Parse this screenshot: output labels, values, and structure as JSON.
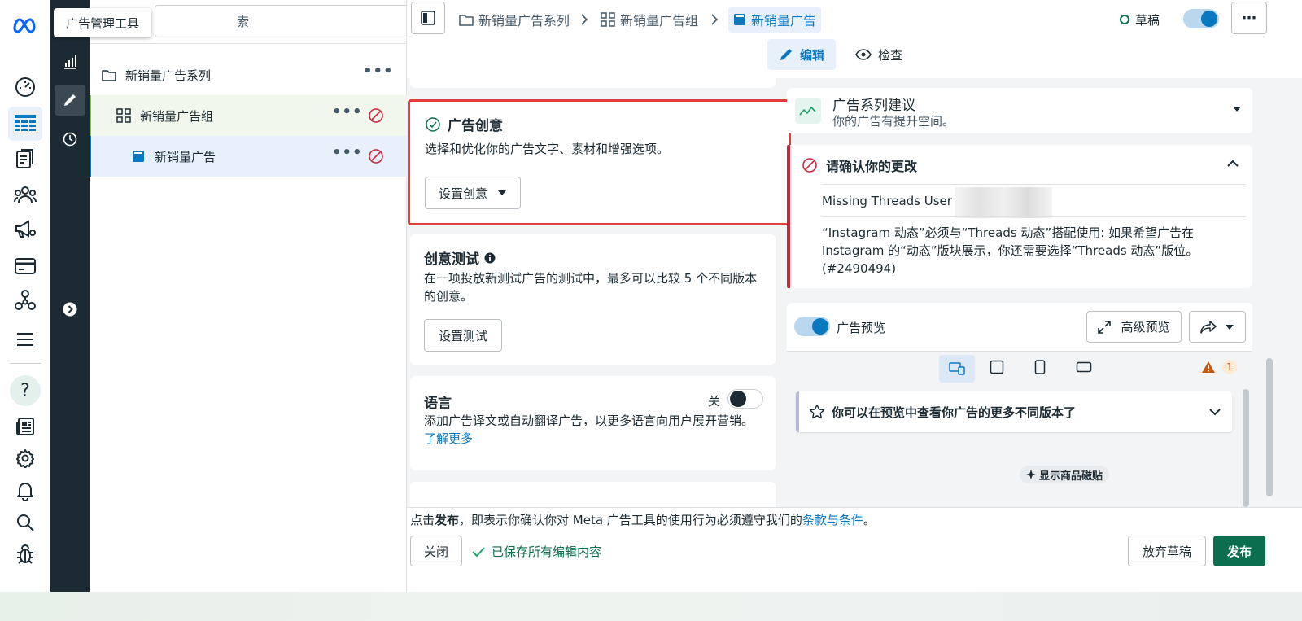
{
  "tooltip": "广告管理工具",
  "search": {
    "placeholder": "索"
  },
  "tree": [
    {
      "label": "新销量广告系列"
    },
    {
      "label": "新销量广告组"
    },
    {
      "label": "新销量广告"
    }
  ],
  "breadcrumb": {
    "campaign": "新销量广告系列",
    "adset": "新销量广告组",
    "ad": "新销量广告"
  },
  "status": {
    "draft": "草稿"
  },
  "modes": {
    "edit": "编辑",
    "inspect": "检查"
  },
  "creative": {
    "title": "广告创意",
    "desc": "选择和优化你的广告文字、素材和增强选项。",
    "button": "设置创意"
  },
  "test": {
    "title": "创意测试",
    "desc": "在一项投放新测试广告的测试中，最多可以比较 5 个不同版本的创意。",
    "button": "设置测试"
  },
  "language": {
    "title": "语言",
    "toggle_label": "关",
    "desc": "添加广告译文或自动翻译广告，以更多语言向用户展开营销。",
    "link": "了解更多"
  },
  "suggest": {
    "title": "广告系列建议",
    "desc": "你的广告有提升空间。"
  },
  "confirm": {
    "title": "请确认你的更改",
    "missing": "Missing Threads User I",
    "message": "“Instagram 动态”必须与“Threads 动态”搭配使用: 如果希望广告在 Instagram 的“动态”版块展示，你还需要选择“Threads 动态”版位。 (#2490494)"
  },
  "preview": {
    "toggle_label": "广告预览",
    "advanced": "高级预览",
    "warning_count": "1",
    "info": "你可以在预览中查看你广告的更多不同版本了",
    "chip": "显示商品磁贴"
  },
  "footer": {
    "terms_prefix": "点击",
    "terms_bold": "发布",
    "terms_middle": "，即表示你确认你对 Meta 广告工具的使用行为必须遵守我们的",
    "terms_link": "条款与条件",
    "terms_suffix": "。",
    "close": "关闭",
    "saved": "已保存所有编辑内容",
    "discard": "放弃草稿",
    "publish": "发布"
  },
  "colors": {
    "accent": "#0a78be",
    "publish": "#0b6e4f",
    "error": "#c8283e",
    "highlight": "#e43d3d"
  }
}
